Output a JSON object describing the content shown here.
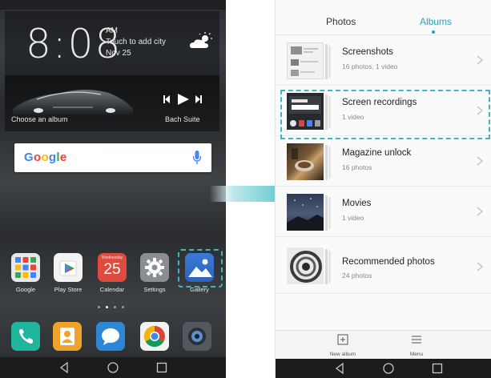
{
  "home": {
    "clock": {
      "time": "8:08",
      "ampm": "AM",
      "city_prompt": "Touch to add city",
      "date": "Nov 25"
    },
    "music": {
      "album_prompt": "Choose an album",
      "song": "Bach Suite"
    },
    "search": {
      "logo_letters": [
        "G",
        "o",
        "o",
        "g",
        "l",
        "e"
      ]
    },
    "apps": [
      {
        "label": "Google"
      },
      {
        "label": "Play Store"
      },
      {
        "label": "Calendar",
        "day_name": "Wednesday",
        "day_number": "25"
      },
      {
        "label": "Settings"
      },
      {
        "label": "Gallery"
      }
    ],
    "dock": [
      "phone-icon",
      "contacts-icon",
      "messages-icon",
      "chrome-icon",
      "camera-icon"
    ]
  },
  "gallery": {
    "tabs": {
      "photos": "Photos",
      "albums": "Albums",
      "active": "albums"
    },
    "albums": [
      {
        "name": "Screenshots",
        "count": "16 photos, 1 video"
      },
      {
        "name": "Screen recordings",
        "count": "1 video"
      },
      {
        "name": "Magazine unlock",
        "count": "16 photos"
      },
      {
        "name": "Movies",
        "count": "1 video"
      },
      {
        "name": "Recommended photos",
        "count": "24 photos"
      }
    ],
    "bottom": {
      "new_album": "New album",
      "menu": "Menu"
    }
  },
  "colors": {
    "accent": "#26a5b7",
    "highlight": "#3fb6bd",
    "arrow": "#3fbfc6"
  }
}
